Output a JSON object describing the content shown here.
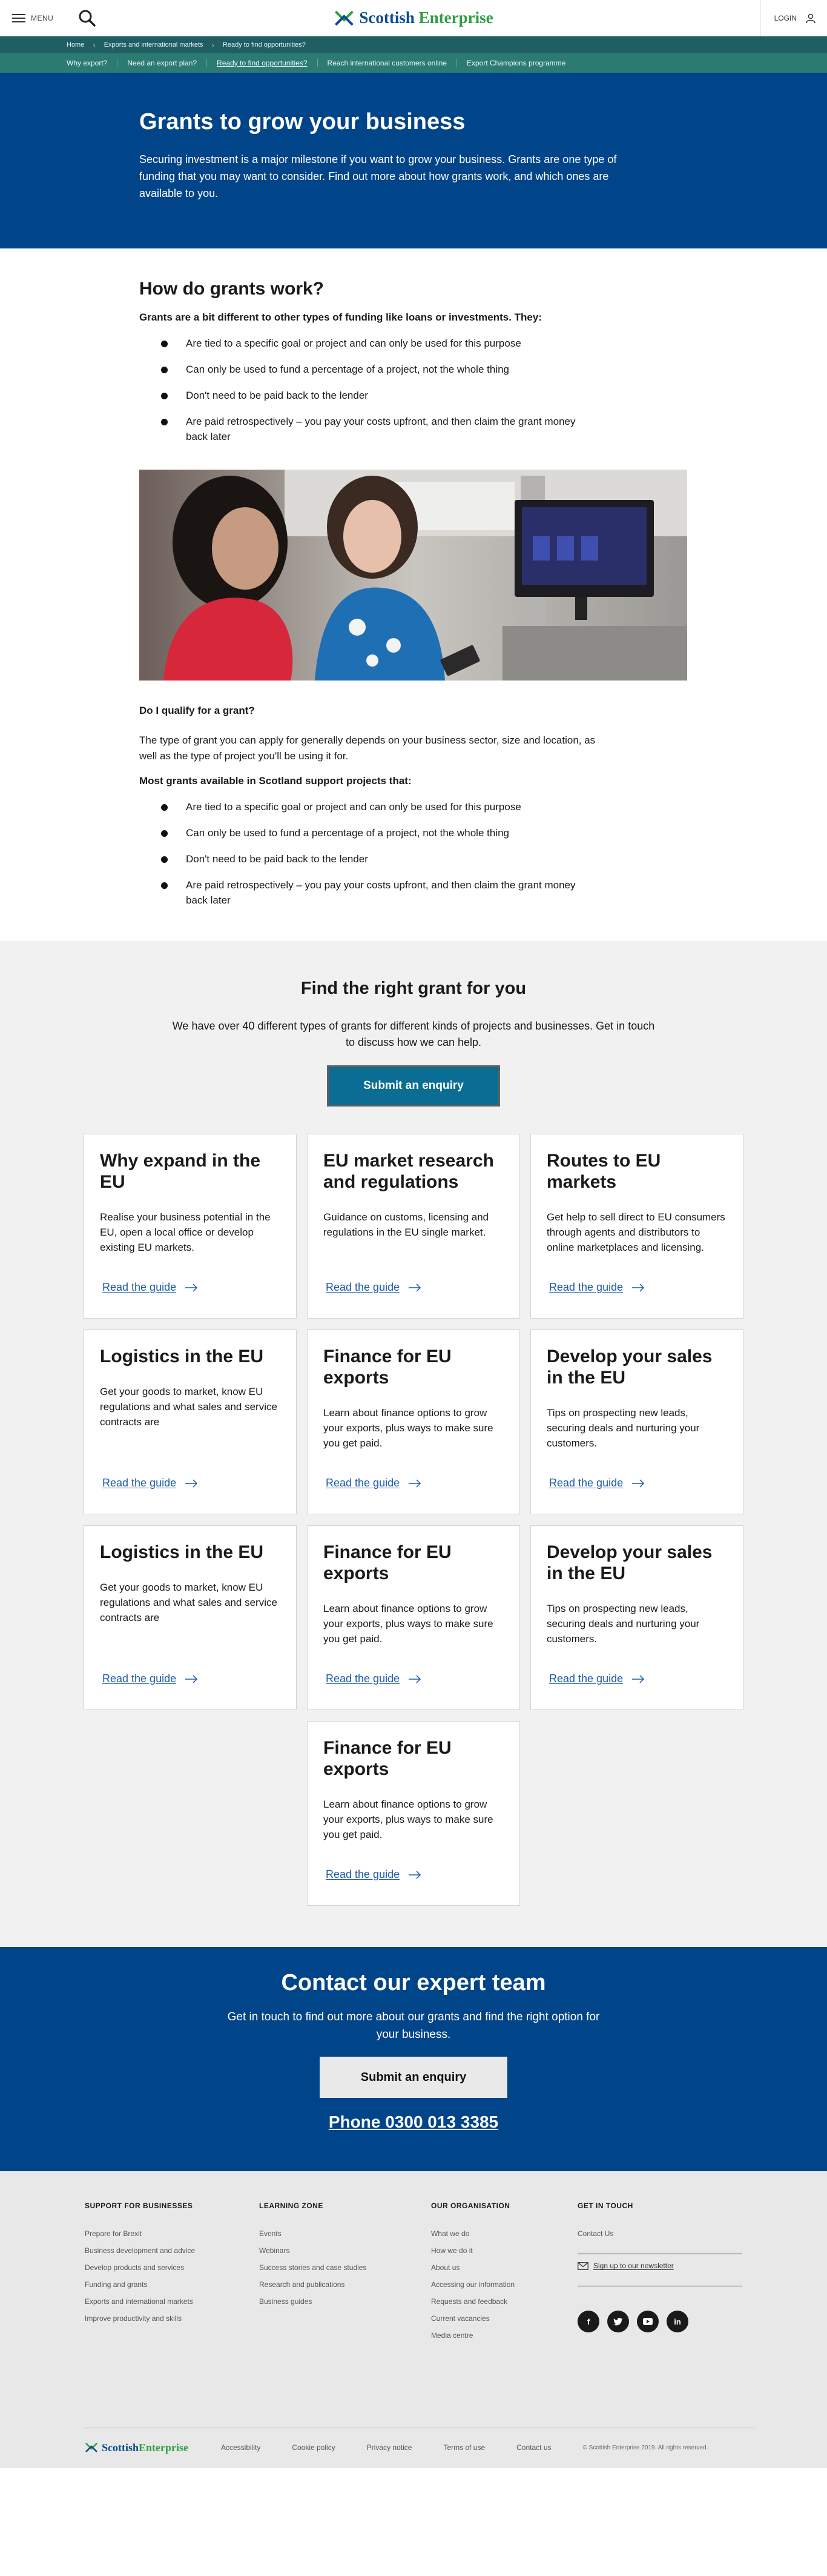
{
  "header": {
    "menu_label": "MENU",
    "logo_part1": "Scottish",
    "logo_part2": "Enterprise",
    "login_label": "LOGIN"
  },
  "breadcrumb": [
    "Home",
    "Exports and international markets",
    "Ready to find opportunities?"
  ],
  "subnav": {
    "items": [
      "Why export?",
      "Need an export plan?",
      "Ready to find opportunities?",
      "Reach international customers online",
      "Export Champions programme"
    ],
    "active_index": 2
  },
  "hero": {
    "title": "Grants to grow your business",
    "text": "Securing investment is a major milestone if you want to grow your business. Grants are one type of funding that you may want to consider. Find out more about how grants work, and which ones are available to you."
  },
  "article": {
    "heading": "How do grants work?",
    "lead": "Grants are a bit different to other types of funding like loans or investments. They:",
    "bullets1": [
      "Are tied to a specific goal or project and can only be used for this purpose",
      "Can only be used to fund a percentage of a project, not the whole thing",
      "Don't need to be paid back to the lender",
      "Are paid retrospectively – you pay your costs upfront, and then claim the grant money back later"
    ],
    "qualify_heading": "Do I qualify for a grant?",
    "qualify_text": "The type of grant you can apply for generally depends on your business sector, size and location, as well as the type of project you'll be using it for.",
    "lead2": "Most grants available in Scotland support projects that:",
    "bullets2": [
      "Are tied to a specific goal or project and can only be used for this purpose",
      "Can only be used to fund a percentage of a project, not the whole thing",
      "Don't need to be paid back to the lender",
      "Are paid retrospectively – you pay your costs upfront, and then claim the grant money back later"
    ]
  },
  "grants": {
    "heading": "Find the right grant for you",
    "intro": "We have over 40 different types of grants for different kinds of projects and businesses. Get in touch to discuss how we can help.",
    "button": "Submit an enquiry",
    "link_label": "Read the guide",
    "cards": [
      {
        "title": "Why expand in the EU",
        "text": "Realise your business potential in the EU, open a local office or develop existing EU markets."
      },
      {
        "title": "EU market research and regulations",
        "text": "Guidance on customs, licensing and regulations in the EU single market."
      },
      {
        "title": "Routes to EU markets",
        "text": "Get help to sell direct to EU consumers through agents and distributors to online marketplaces and licensing."
      },
      {
        "title": "Logistics in the EU",
        "text": "Get your goods to market, know EU regulations and what sales and service contracts are"
      },
      {
        "title": "Finance for EU exports",
        "text": "Learn about finance options to grow your exports, plus ways to make sure you get paid."
      },
      {
        "title": "Develop your sales in the EU",
        "text": "Tips on prospecting new leads, securing deals and nurturing your customers."
      },
      {
        "title": "Logistics in the EU",
        "text": "Get your goods to market, know EU regulations and what sales and service contracts are"
      },
      {
        "title": "Finance for EU exports",
        "text": "Learn about finance options to grow your exports, plus ways to make sure you get paid."
      },
      {
        "title": "Develop your sales in the EU",
        "text": "Tips on prospecting new leads, securing deals and nurturing your customers."
      },
      {
        "title": "Finance for EU exports",
        "text": "Learn about finance options to grow your exports, plus ways to make sure you get paid."
      }
    ]
  },
  "contact": {
    "heading": "Contact our expert team",
    "text": "Get in touch to find out more about our grants and find the right option for your business.",
    "button": "Submit an enquiry",
    "phone": "Phone 0300 013 3385"
  },
  "footer": {
    "col1": {
      "heading": "SUPPORT FOR BUSINESSES",
      "items": [
        "Prepare for Brexit",
        "Business development and advice",
        "Develop products and services",
        "Funding and grants",
        "Exports and international markets",
        "Improve productivity and skills"
      ]
    },
    "col2": {
      "heading": "LEARNING ZONE",
      "items": [
        "Events",
        "Webinars",
        "Success stories and case studies",
        "Research and publications",
        "Business guides"
      ]
    },
    "col3": {
      "heading": "OUR ORGANISATION",
      "items": [
        "What we do",
        "How we do it",
        "About us",
        "Accessing our information",
        "Requests and feedback",
        "Current vacancies",
        "Media centre"
      ]
    },
    "col4": {
      "heading": "GET IN TOUCH",
      "items": [
        "Contact Us"
      ],
      "newsletter": "Sign up to our newsletter"
    },
    "bottom_links": [
      "Accessibility",
      "Cookie policy",
      "Privacy notice",
      "Terms of use",
      "Contact us"
    ],
    "copyright": "© Scottish Enterprise 2019. All rights reserved."
  }
}
